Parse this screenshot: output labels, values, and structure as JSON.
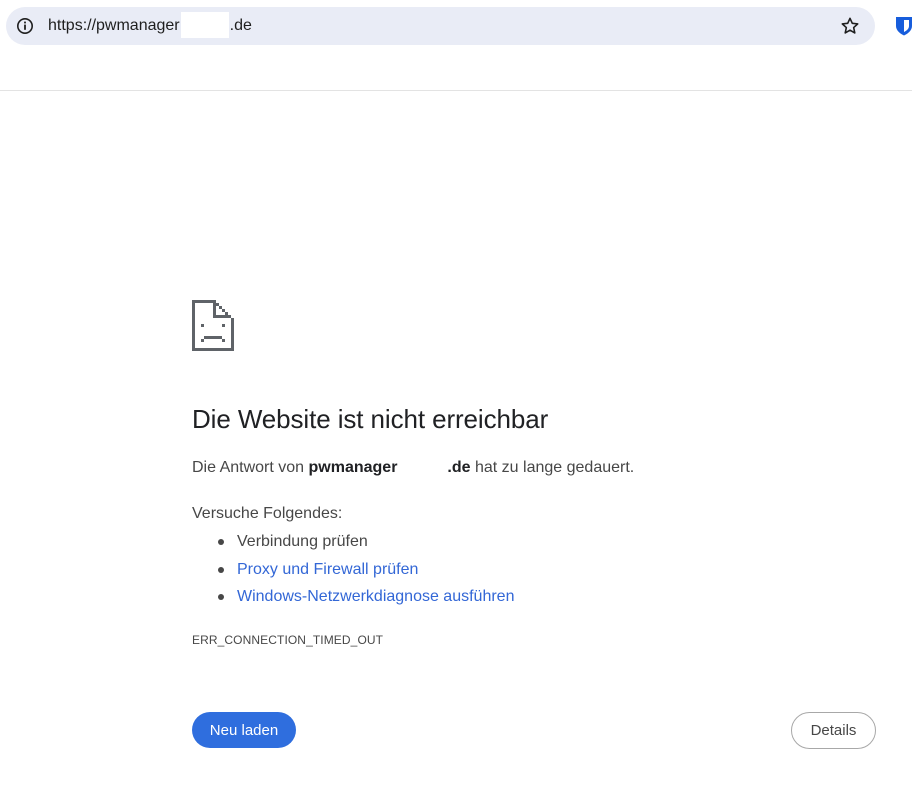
{
  "browser": {
    "url_prefix": "https://pwmanager",
    "url_suffix": ".de",
    "info_icon": "info-icon",
    "bookmark_icon": "star-outline-icon",
    "extension_icon": "bitwarden-shield-icon"
  },
  "error": {
    "icon": "sad-page-icon",
    "title": "Die Website ist nicht erreichbar",
    "summary_prefix": "Die Antwort von ",
    "host_prefix": "pwmanager",
    "host_suffix": ".de",
    "summary_suffix": " hat zu lange gedauert.",
    "suggestions_title": "Versuche Folgendes:",
    "suggestions": [
      {
        "label": "Verbindung prüfen",
        "is_link": false
      },
      {
        "label": "Proxy und Firewall prüfen",
        "is_link": true
      },
      {
        "label": "Windows-Netzwerkdiagnose ausführen",
        "is_link": true
      }
    ],
    "code": "ERR_CONNECTION_TIMED_OUT"
  },
  "buttons": {
    "reload_label": "Neu laden",
    "details_label": "Details"
  },
  "colors": {
    "primary_button": "#2f6ede",
    "link": "#3367d6",
    "omnibox_bg": "#e9ecf6"
  }
}
